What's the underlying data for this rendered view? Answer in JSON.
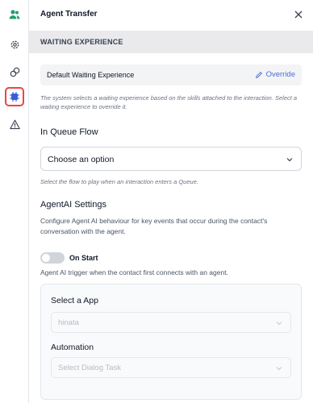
{
  "panel": {
    "title": "Agent Transfer"
  },
  "waiting_experience": {
    "section_title": "WAITING EXPERIENCE",
    "current": "Default Waiting Experience",
    "override_label": "Override",
    "note": "The system selects a waiting experience based on the skills attached to the interaction. Select a waiting experience to override it."
  },
  "queue_flow": {
    "heading": "In Queue Flow",
    "placeholder": "Choose an option",
    "note": "Select the flow to play when an interaction enters a Queue."
  },
  "agentai": {
    "heading": "AgentAI Settings",
    "description": "Configure Agent AI behaviour for key events that occur during the contact's conversation with the agent.",
    "on_start_label": "On Start",
    "on_start_enabled": false,
    "on_start_note": "Agent AI trigger when the contact first connects with an agent.",
    "select_app_label": "Select a App",
    "app_value": "hinata",
    "automation_label": "Automation",
    "automation_placeholder": "Select Dialog Task"
  },
  "colors": {
    "accent": "#4f6bd8",
    "active_highlight": "#ef4444",
    "rail_icon": "#374151",
    "rail_user_icon": "#22a06b",
    "active_icon": "#3b5bdb"
  },
  "rail": {
    "icons": [
      "users-icon",
      "settings-icon",
      "transfer-icon",
      "bot-icon",
      "warning-icon"
    ],
    "active": "bot-icon"
  }
}
